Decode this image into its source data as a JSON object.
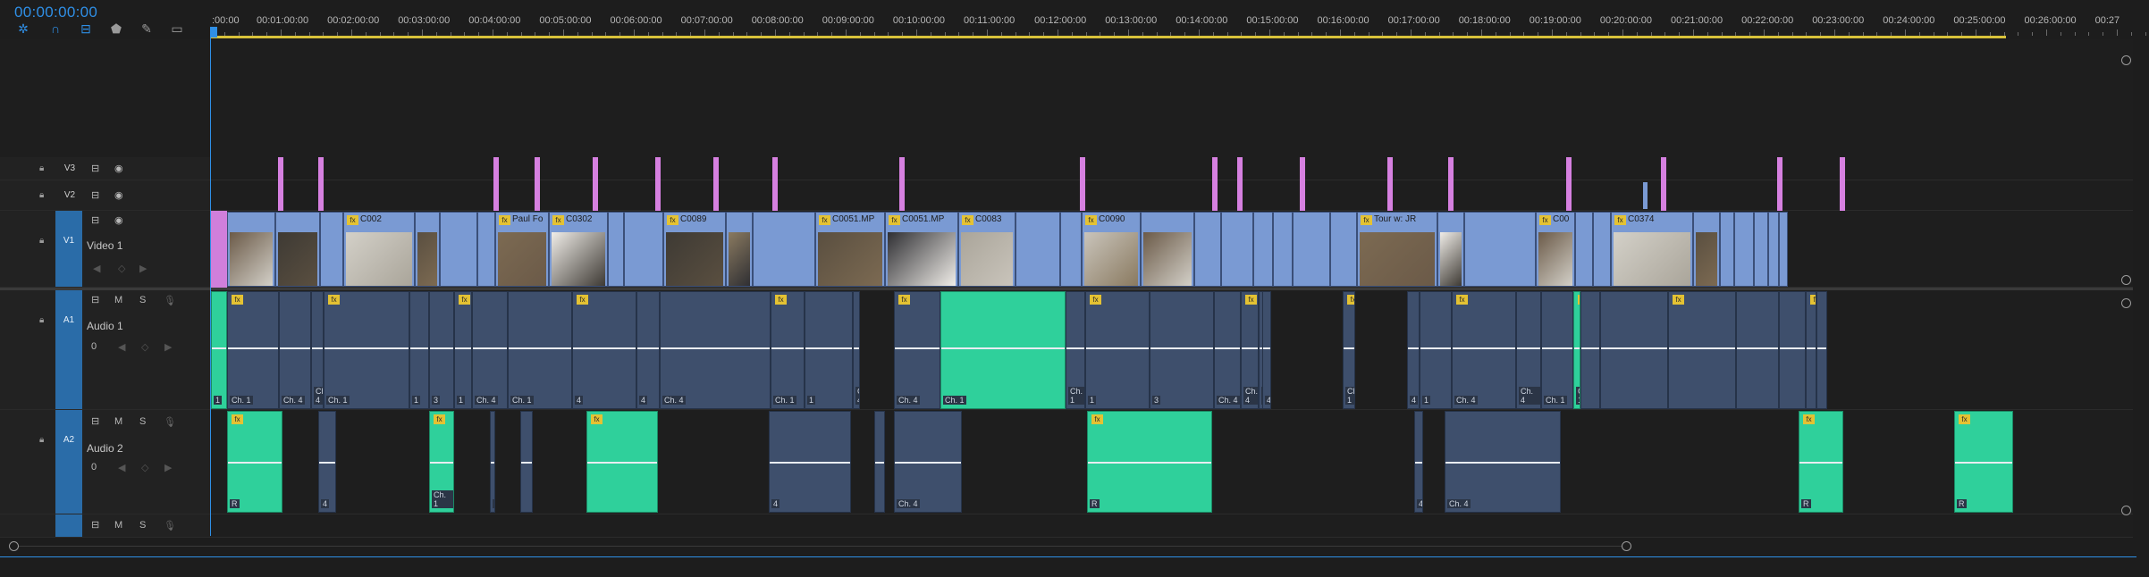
{
  "timecode": "00:00:00:00",
  "toolbar": [
    {
      "icon": "snap-icon",
      "glyph": "✲",
      "active": true
    },
    {
      "icon": "linked-selection-icon",
      "glyph": "∩",
      "active": true
    },
    {
      "icon": "add-marker-icon",
      "glyph": "⊟",
      "active": true
    },
    {
      "icon": "marker-icon",
      "glyph": "⬟",
      "active": false
    },
    {
      "icon": "wrench-icon",
      "glyph": "✎",
      "active": false
    },
    {
      "icon": "captions-icon",
      "glyph": "▭",
      "active": false
    }
  ],
  "ruler": {
    "labels": [
      ":00:00",
      "00:01:00:00",
      "00:02:00:00",
      "00:03:00:00",
      "00:04:00:00",
      "00:05:00:00",
      "00:06:00:00",
      "00:07:00:00",
      "00:08:00:00",
      "00:09:00:00",
      "00:10:00:00",
      "00:11:00:00",
      "00:12:00:00",
      "00:13:00:00",
      "00:14:00:00",
      "00:15:00:00",
      "00:16:00:00",
      "00:17:00:00",
      "00:18:00:00",
      "00:19:00:00",
      "00:20:00:00",
      "00:21:00:00",
      "00:22:00:00",
      "00:23:00:00",
      "00:24:00:00",
      "00:25:00:00",
      "00:26:00:00",
      "00:27"
    ]
  },
  "tracks": {
    "v3": {
      "label": "V3"
    },
    "v2": {
      "label": "V2"
    },
    "v1": {
      "label": "V1",
      "name": "Video 1"
    },
    "a1": {
      "label": "A1",
      "name": "Audio 1",
      "volume": "0"
    },
    "a2": {
      "label": "A2",
      "name": "Audio 2",
      "volume": "0"
    },
    "a3": {
      "label": "",
      "name": ""
    }
  },
  "header_buttons": {
    "mute": "M",
    "solo": "S"
  },
  "video_clip_names": [
    "C002",
    "Paul Fo",
    "C0302",
    "C0089",
    "C0051.MP",
    "C0051.MP",
    "C0083",
    "C0090",
    "Tour w: JR",
    "C00",
    "C0374"
  ],
  "channel_labels": {
    "a1": [
      "1",
      "Ch. 1",
      "Ch. 4",
      "Ch. 4",
      "Ch. 1",
      "1",
      "3",
      "1",
      "Ch. 4",
      "Ch. 1",
      "4",
      "4",
      "Ch. 4",
      "Ch. 1",
      "1",
      "Ch. 4",
      "Ch. 4",
      "Ch. 1",
      "Ch. 1",
      "1",
      "3",
      "Ch. 4",
      "Ch. 4",
      "Ch. 4",
      "4",
      "Ch. 1",
      "4",
      "1",
      "Ch. 4",
      "Ch. 4",
      "Ch. 1",
      "Ch. 1"
    ],
    "a2": [
      "R",
      "4",
      "Ch. 1",
      "R",
      "Ch. 4",
      "4",
      "Ch. 4",
      "R",
      "4",
      "Ch. 4",
      "Ch. 4",
      "R",
      "R"
    ]
  },
  "colors": {
    "accent": "#2f8fe6",
    "video_clip": "#7a9ad3",
    "audio_clip": "#3e4f6c",
    "audio_clip_selected": "#2fd09b",
    "marker": "#d680e0",
    "fx_badge": "#e4c233",
    "work_area": "#d8c23a"
  }
}
